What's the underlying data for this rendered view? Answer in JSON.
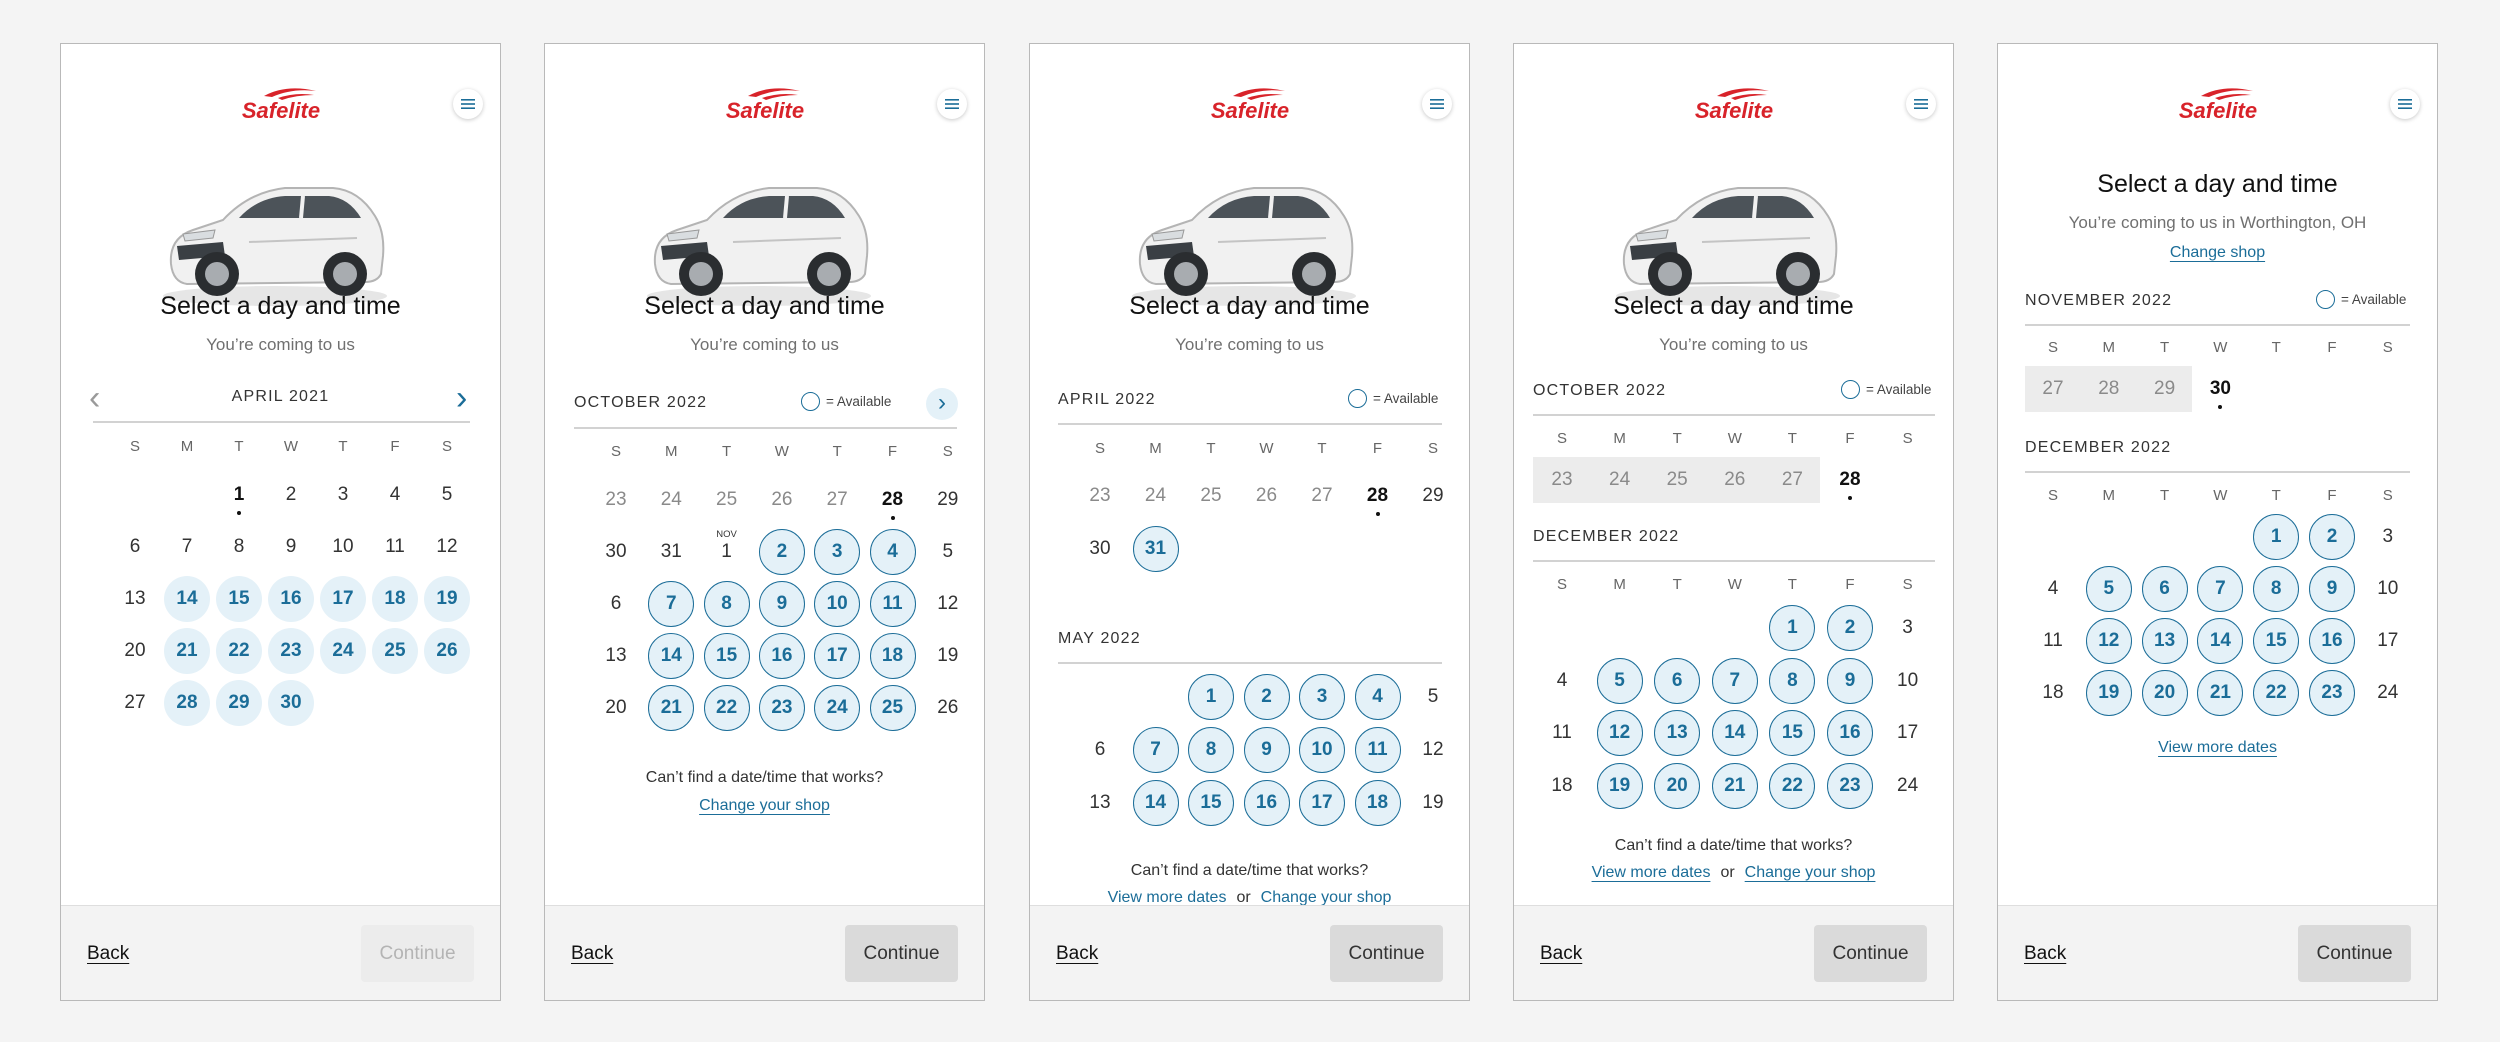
{
  "brand": "Safelite",
  "colors": {
    "accent": "#1b6d98",
    "brand_red": "#d8232a",
    "available_fill": "#e4f1f8"
  },
  "icons": {
    "menu": "menu-icon",
    "prev": "chevron-left-icon",
    "next": "chevron-right-icon"
  },
  "common": {
    "title": "Select a day and time",
    "coming_to_us": "You’re coming to us",
    "available_legend": "= Available",
    "cant_find": "Can’t find a date/time that works?",
    "change_your_shop": "Change your shop",
    "view_more_dates": "View more dates",
    "or": "or",
    "back": "Back",
    "continue": "Continue",
    "weekdays": [
      "S",
      "M",
      "T",
      "W",
      "T",
      "F",
      "S"
    ]
  },
  "panels": [
    {
      "month_label": "APRIL 2021",
      "weeks": [
        [
          {
            "t": ""
          },
          {
            "t": ""
          },
          {
            "t": "1",
            "s": "today"
          },
          {
            "t": "2"
          },
          {
            "t": "3"
          },
          {
            "t": "4"
          },
          {
            "t": "5"
          }
        ],
        [
          {
            "t": "6"
          },
          {
            "t": "7"
          },
          {
            "t": "8"
          },
          {
            "t": "9"
          },
          {
            "t": "10"
          },
          {
            "t": "11"
          },
          {
            "t": "12"
          }
        ],
        [
          {
            "t": "13"
          },
          {
            "t": "14",
            "s": "pill"
          },
          {
            "t": "15",
            "s": "pill"
          },
          {
            "t": "16",
            "s": "pill"
          },
          {
            "t": "17",
            "s": "pill"
          },
          {
            "t": "18",
            "s": "pill"
          },
          {
            "t": "19",
            "s": "pill"
          }
        ],
        [
          {
            "t": "20"
          },
          {
            "t": "21",
            "s": "pill"
          },
          {
            "t": "22",
            "s": "pill"
          },
          {
            "t": "23",
            "s": "pill"
          },
          {
            "t": "24",
            "s": "pill"
          },
          {
            "t": "25",
            "s": "pill"
          },
          {
            "t": "26",
            "s": "pill"
          }
        ],
        [
          {
            "t": "27"
          },
          {
            "t": "28",
            "s": "pill"
          },
          {
            "t": "29",
            "s": "pill"
          },
          {
            "t": "30",
            "s": "pill"
          },
          {
            "t": ""
          },
          {
            "t": ""
          },
          {
            "t": ""
          }
        ]
      ]
    },
    {
      "month_label": "OCTOBER 2022",
      "weeks": [
        [
          {
            "t": "23",
            "s": "muted"
          },
          {
            "t": "24",
            "s": "muted"
          },
          {
            "t": "25",
            "s": "muted"
          },
          {
            "t": "26",
            "s": "muted"
          },
          {
            "t": "27",
            "s": "muted"
          },
          {
            "t": "28",
            "s": "today"
          },
          {
            "t": "29"
          }
        ],
        [
          {
            "t": "30"
          },
          {
            "t": "31"
          },
          {
            "t": "1",
            "tiny": "NOV"
          },
          {
            "t": "2",
            "s": "ring"
          },
          {
            "t": "3",
            "s": "ring"
          },
          {
            "t": "4",
            "s": "ring"
          },
          {
            "t": "5"
          }
        ],
        [
          {
            "t": "6"
          },
          {
            "t": "7",
            "s": "ring"
          },
          {
            "t": "8",
            "s": "ring"
          },
          {
            "t": "9",
            "s": "ring"
          },
          {
            "t": "10",
            "s": "ring"
          },
          {
            "t": "11",
            "s": "ring"
          },
          {
            "t": "12"
          }
        ],
        [
          {
            "t": "13"
          },
          {
            "t": "14",
            "s": "ring"
          },
          {
            "t": "15",
            "s": "ring"
          },
          {
            "t": "16",
            "s": "ring"
          },
          {
            "t": "17",
            "s": "ring"
          },
          {
            "t": "18",
            "s": "ring"
          },
          {
            "t": "19"
          }
        ],
        [
          {
            "t": "20"
          },
          {
            "t": "21",
            "s": "ring"
          },
          {
            "t": "22",
            "s": "ring"
          },
          {
            "t": "23",
            "s": "ring"
          },
          {
            "t": "24",
            "s": "ring"
          },
          {
            "t": "25",
            "s": "ring"
          },
          {
            "t": "26"
          }
        ]
      ]
    },
    {
      "month1_label": "APRIL 2022",
      "weeks1": [
        [
          {
            "t": "23",
            "s": "muted"
          },
          {
            "t": "24",
            "s": "muted"
          },
          {
            "t": "25",
            "s": "muted"
          },
          {
            "t": "26",
            "s": "muted"
          },
          {
            "t": "27",
            "s": "muted"
          },
          {
            "t": "28",
            "s": "today"
          },
          {
            "t": "29"
          }
        ],
        [
          {
            "t": "30"
          },
          {
            "t": "31",
            "s": "ring"
          },
          {
            "t": ""
          },
          {
            "t": ""
          },
          {
            "t": ""
          },
          {
            "t": ""
          },
          {
            "t": ""
          }
        ]
      ],
      "month2_label": "MAY 2022",
      "weeks2": [
        [
          {
            "t": ""
          },
          {
            "t": ""
          },
          {
            "t": "1",
            "s": "ring"
          },
          {
            "t": "2",
            "s": "ring"
          },
          {
            "t": "3",
            "s": "ring"
          },
          {
            "t": "4",
            "s": "ring"
          },
          {
            "t": "5"
          }
        ],
        [
          {
            "t": "6"
          },
          {
            "t": "7",
            "s": "ring"
          },
          {
            "t": "8",
            "s": "ring"
          },
          {
            "t": "9",
            "s": "ring"
          },
          {
            "t": "10",
            "s": "ring"
          },
          {
            "t": "11",
            "s": "ring"
          },
          {
            "t": "12"
          }
        ],
        [
          {
            "t": "13"
          },
          {
            "t": "14",
            "s": "ring"
          },
          {
            "t": "15",
            "s": "ring"
          },
          {
            "t": "16",
            "s": "ring"
          },
          {
            "t": "17",
            "s": "ring"
          },
          {
            "t": "18",
            "s": "ring"
          },
          {
            "t": "19"
          }
        ]
      ]
    },
    {
      "month1_label": "OCTOBER 2022",
      "weeks1": [
        [
          {
            "t": "23",
            "s": "muted"
          },
          {
            "t": "24",
            "s": "muted"
          },
          {
            "t": "25",
            "s": "muted"
          },
          {
            "t": "26",
            "s": "muted"
          },
          {
            "t": "27",
            "s": "muted"
          },
          {
            "t": "28",
            "s": "today"
          },
          {
            "t": ""
          }
        ]
      ],
      "month2_label": "DECEMBER 2022",
      "weeks2": [
        [
          {
            "t": ""
          },
          {
            "t": ""
          },
          {
            "t": ""
          },
          {
            "t": ""
          },
          {
            "t": "1",
            "s": "ring"
          },
          {
            "t": "2",
            "s": "ring"
          },
          {
            "t": "3"
          }
        ],
        [
          {
            "t": "4"
          },
          {
            "t": "5",
            "s": "ring"
          },
          {
            "t": "6",
            "s": "ring"
          },
          {
            "t": "7",
            "s": "ring"
          },
          {
            "t": "8",
            "s": "ring"
          },
          {
            "t": "9",
            "s": "ring"
          },
          {
            "t": "10"
          }
        ],
        [
          {
            "t": "11"
          },
          {
            "t": "12",
            "s": "ring"
          },
          {
            "t": "13",
            "s": "ring"
          },
          {
            "t": "14",
            "s": "ring"
          },
          {
            "t": "15",
            "s": "ring"
          },
          {
            "t": "16",
            "s": "ring"
          },
          {
            "t": "17"
          }
        ],
        [
          {
            "t": "18"
          },
          {
            "t": "19",
            "s": "ring"
          },
          {
            "t": "20",
            "s": "ring"
          },
          {
            "t": "21",
            "s": "ring"
          },
          {
            "t": "22",
            "s": "ring"
          },
          {
            "t": "23",
            "s": "ring"
          },
          {
            "t": "24"
          }
        ]
      ]
    },
    {
      "location": "You’re coming to us in Worthington, OH",
      "change_shop": "Change shop",
      "month1_label": "NOVEMBER 2022",
      "weeks1": [
        [
          {
            "t": "27",
            "s": "muted"
          },
          {
            "t": "28",
            "s": "muted"
          },
          {
            "t": "29",
            "s": "muted"
          },
          {
            "t": "30",
            "s": "today"
          },
          {
            "t": ""
          },
          {
            "t": ""
          },
          {
            "t": ""
          }
        ]
      ],
      "month2_label": "DECEMBER 2022",
      "weeks2": [
        [
          {
            "t": ""
          },
          {
            "t": ""
          },
          {
            "t": ""
          },
          {
            "t": ""
          },
          {
            "t": "1",
            "s": "ring"
          },
          {
            "t": "2",
            "s": "ring"
          },
          {
            "t": "3"
          }
        ],
        [
          {
            "t": "4"
          },
          {
            "t": "5",
            "s": "ring"
          },
          {
            "t": "6",
            "s": "ring"
          },
          {
            "t": "7",
            "s": "ring"
          },
          {
            "t": "8",
            "s": "ring"
          },
          {
            "t": "9",
            "s": "ring"
          },
          {
            "t": "10"
          }
        ],
        [
          {
            "t": "11"
          },
          {
            "t": "12",
            "s": "ring"
          },
          {
            "t": "13",
            "s": "ring"
          },
          {
            "t": "14",
            "s": "ring"
          },
          {
            "t": "15",
            "s": "ring"
          },
          {
            "t": "16",
            "s": "ring"
          },
          {
            "t": "17"
          }
        ],
        [
          {
            "t": "18"
          },
          {
            "t": "19",
            "s": "ring"
          },
          {
            "t": "20",
            "s": "ring"
          },
          {
            "t": "21",
            "s": "ring"
          },
          {
            "t": "22",
            "s": "ring"
          },
          {
            "t": "23",
            "s": "ring"
          },
          {
            "t": "24"
          }
        ]
      ]
    }
  ]
}
